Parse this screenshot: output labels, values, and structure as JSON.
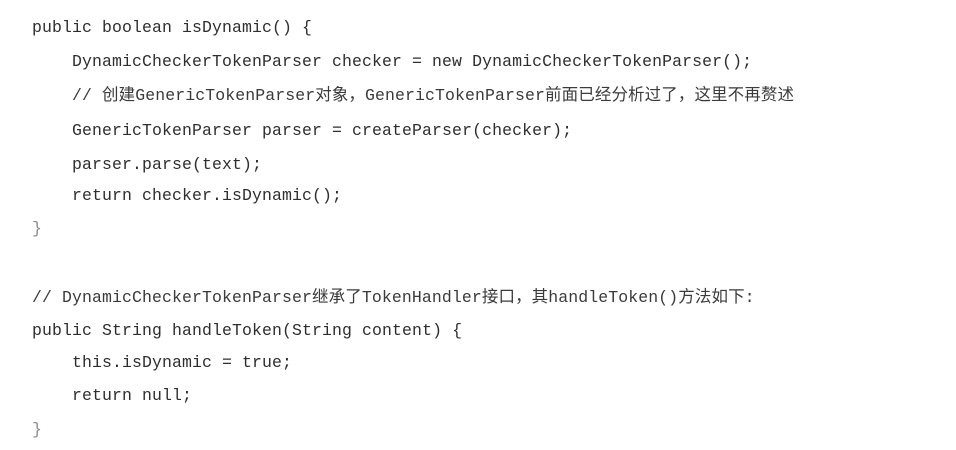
{
  "code": {
    "lines": [
      "public boolean isDynamic() {",
      "DynamicCheckerTokenParser checker = new DynamicCheckerTokenParser();",
      "// 创建GenericTokenParser对象，GenericTokenParser前面已经分析过了，这里不再赘述",
      "GenericTokenParser parser = createParser(checker);",
      "parser.parse(text);",
      "return checker.isDynamic();",
      "}",
      "// DynamicCheckerTokenParser继承了TokenHandler接口，其handleToken()方法如下:",
      "public String handleToken(String content) {",
      "this.isDynamic = true;",
      "return null;",
      "}"
    ]
  }
}
